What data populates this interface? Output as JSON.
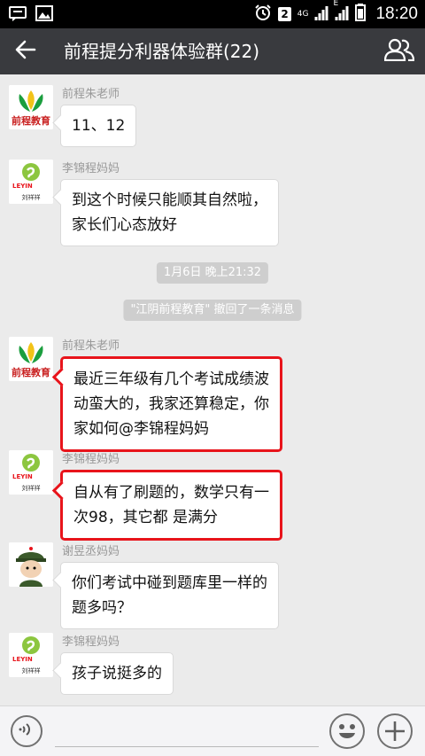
{
  "status_bar": {
    "sim_badge": "2",
    "network": "4G",
    "network_sub": "E",
    "time": "18:20"
  },
  "header": {
    "title": "前程提分利器体验群(22)",
    "back_icon": "arrow-left-icon",
    "members_icon": "group-members-icon"
  },
  "avatars": {
    "zhu": {
      "logo_text": "前程教育",
      "colors": [
        "#c81e1e",
        "#1b9e3e",
        "#f2c318"
      ]
    },
    "li": {
      "logo_text": "LEYIN",
      "caption": "刘祥祥",
      "colors": [
        "#8cc63f",
        "#e8141b"
      ]
    },
    "xie": {
      "colors": [
        "#3b5a2b",
        "#f2d2b4"
      ]
    }
  },
  "messages": [
    {
      "sender": "前程朱老师",
      "avatar": "zhu",
      "lines": [
        "11、12"
      ],
      "highlight": false
    },
    {
      "sender": "李锦程妈妈",
      "avatar": "li",
      "lines": [
        "到这个时候只能顺其自然啦，",
        "家长们心态放好"
      ],
      "highlight": false
    },
    {
      "sender": "前程朱老师",
      "avatar": "zhu",
      "lines": [
        "最近三年级有几个考试成绩波",
        "动蛮大的，我家还算稳定，你",
        "家如何@李锦程妈妈"
      ],
      "highlight": true
    },
    {
      "sender": "李锦程妈妈",
      "avatar": "li",
      "lines": [
        "自从有了刷题的，数学只有一",
        "次98，其它都 是满分"
      ],
      "highlight": true
    },
    {
      "sender": "谢昱丞妈妈",
      "avatar": "xie",
      "lines": [
        "你们考试中碰到题库里一样的",
        "题多吗？"
      ],
      "highlight": false
    },
    {
      "sender": "李锦程妈妈",
      "avatar": "li",
      "lines": [
        "孩子说挺多的"
      ],
      "highlight": false
    }
  ],
  "system": {
    "timestamp": "1月6日 晚上21:32",
    "recall_notice": "\"江阴前程教育\" 撤回了一条消息"
  },
  "input_bar": {
    "placeholder": "",
    "voice_icon": "voice-input-icon",
    "emoji_icon": "emoji-icon",
    "plus_icon": "plus-icon"
  }
}
